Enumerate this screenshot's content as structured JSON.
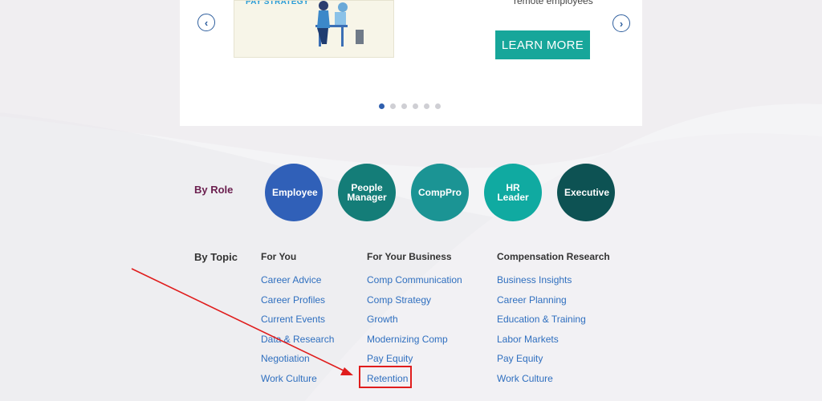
{
  "carousel": {
    "prev_icon": "‹",
    "next_icon": "›",
    "thumb_title": "PAY STRATEGY",
    "subtext": "remote employees",
    "cta_label": "LEARN MORE",
    "slide_count": 6,
    "active_slide": 1
  },
  "by_role": {
    "label": "By Role",
    "roles": [
      {
        "label": "Employee",
        "color": "#3060b8"
      },
      {
        "label": "People Manager",
        "color": "#147d78"
      },
      {
        "label": "CompPro",
        "color": "#1b9494"
      },
      {
        "label": "HR Leader",
        "color": "#10aaa1"
      },
      {
        "label": "Executive",
        "color": "#0d5253"
      }
    ]
  },
  "by_topic": {
    "label": "By Topic",
    "columns": [
      {
        "heading": "For You",
        "links": [
          "Career Advice",
          "Career Profiles",
          "Current Events",
          "Data & Research",
          "Negotiation",
          "Work Culture"
        ]
      },
      {
        "heading": "For Your Business",
        "links": [
          "Comp Communication",
          "Comp Strategy",
          "Growth",
          "Modernizing Comp",
          "Pay Equity",
          "Retention"
        ]
      },
      {
        "heading": "Compensation Research",
        "links": [
          "Business Insights",
          "Career Planning",
          "Education & Training",
          "Labor Markets",
          "Pay Equity",
          "Work Culture"
        ]
      }
    ]
  },
  "colors": {
    "label_role": "#6b1f4f",
    "label_topic": "#333333",
    "link": "#2f6fbf",
    "cta": "#17a69a",
    "annotation": "#e01d1d"
  }
}
